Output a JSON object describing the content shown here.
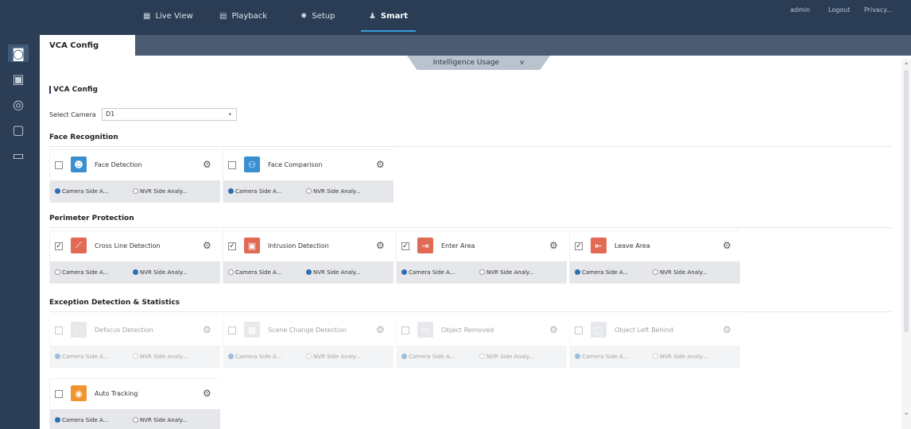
{
  "nav": {
    "items": [
      {
        "label": "Live View",
        "icon": "monitor-icon"
      },
      {
        "label": "Playback",
        "icon": "film-icon"
      },
      {
        "label": "Setup",
        "icon": "gear-icon"
      },
      {
        "label": "Smart",
        "icon": "smart-person-icon"
      }
    ],
    "active": "Smart",
    "right_links": [
      "admin",
      "Logout",
      "Privacy..."
    ]
  },
  "rail": {
    "items": [
      "camera-icon",
      "face-icon",
      "target-icon",
      "vehicle-icon",
      "car-icon"
    ]
  },
  "tab": "VCA Config",
  "usage": {
    "label": "Intelligence Usage",
    "chevron": "v"
  },
  "page": {
    "title": "VCA Config",
    "select_camera_label": "Select Camera",
    "select_camera_value": "D1"
  },
  "sections": [
    {
      "title": "Face Recognition",
      "cards": [
        {
          "name": "Face Detection",
          "checked": false,
          "icon_color": "#3a8fd1",
          "icon": "face-detect-icon",
          "left": "Camera Side A...",
          "right": "NVR Side Analy...",
          "selected": "left",
          "disabled": false
        },
        {
          "name": "Face Comparison",
          "checked": false,
          "icon_color": "#3a8fd1",
          "icon": "face-compare-icon",
          "left": "Camera Side A...",
          "right": "NVR Side Analy...",
          "selected": "left",
          "disabled": false
        }
      ]
    },
    {
      "title": "Perimeter Protection",
      "cards": [
        {
          "name": "Cross Line Detection",
          "checked": true,
          "icon_color": "#e26a55",
          "icon": "cross-line-icon",
          "left": "Camera Side A...",
          "right": "NVR Side Analy...",
          "selected": "right",
          "disabled": false
        },
        {
          "name": "Intrusion Detection",
          "checked": true,
          "icon_color": "#e26a55",
          "icon": "intrusion-icon",
          "left": "Camera Side A...",
          "right": "NVR Side Analy...",
          "selected": "right",
          "disabled": false
        },
        {
          "name": "Enter Area",
          "checked": true,
          "icon_color": "#e26a55",
          "icon": "enter-area-icon",
          "left": "Camera Side A...",
          "right": "NVR Side Analy...",
          "selected": "left",
          "disabled": false
        },
        {
          "name": "Leave Area",
          "checked": true,
          "icon_color": "#e26a55",
          "icon": "leave-area-icon",
          "left": "Camera Side A...",
          "right": "NVR Side Analy...",
          "selected": "left",
          "disabled": false
        }
      ]
    },
    {
      "title": "Exception Detection & Statistics",
      "cards": [
        {
          "name": "Defocus Detection",
          "checked": false,
          "icon_color": "#c9ced5",
          "icon": "defocus-icon",
          "left": "Camera Side A...",
          "right": "NVR Side Analy...",
          "selected": "left",
          "disabled": true
        },
        {
          "name": "Scene Change Detection",
          "checked": false,
          "icon_color": "#c9ced5",
          "icon": "scene-change-icon",
          "left": "Camera Side A...",
          "right": "NVR Side Analy...",
          "selected": "left",
          "disabled": true
        },
        {
          "name": "Object Removed",
          "checked": false,
          "icon_color": "#c9ced5",
          "icon": "object-removed-icon",
          "left": "Camera Side A...",
          "right": "NVR Side Analy...",
          "selected": "left",
          "disabled": true
        },
        {
          "name": "Object Left Behind",
          "checked": false,
          "icon_color": "#c9ced5",
          "icon": "object-left-icon",
          "left": "Camera Side A...",
          "right": "NVR Side Analy...",
          "selected": "left",
          "disabled": true
        },
        {
          "name": "Auto Tracking",
          "checked": false,
          "icon_color": "#f0952f",
          "icon": "auto-tracking-icon",
          "left": "Camera Side A...",
          "right": "NVR Side Analy...",
          "selected": "left",
          "disabled": false
        }
      ]
    }
  ]
}
